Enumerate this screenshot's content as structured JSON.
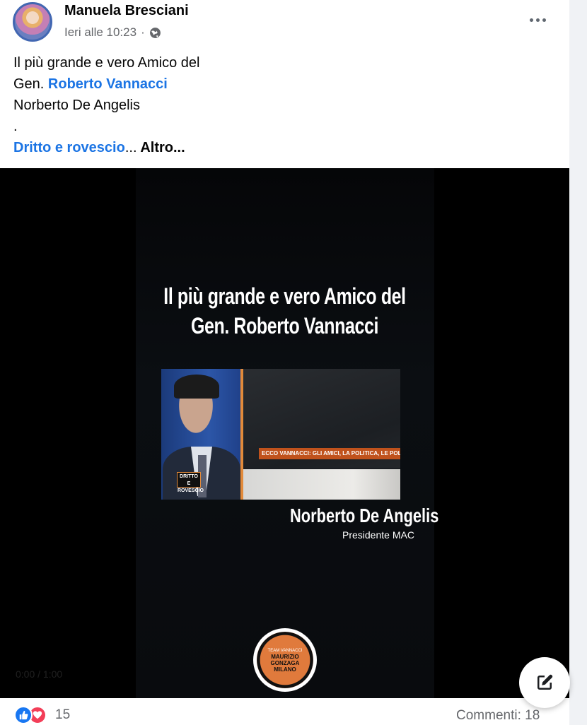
{
  "post": {
    "author": "Manuela Bresciani",
    "timestamp": "Ieri alle 10:23",
    "separator": "·",
    "privacy_icon": "globe-icon",
    "menu_icon": "more-options-icon",
    "caption": {
      "line1": "Il più grande e vero Amico del",
      "line2_prefix": "Gen. ",
      "line2_link": "Roberto Vannacci",
      "line3": "Norberto De Angelis",
      "line4": ".",
      "line5_link": "Dritto e rovescio",
      "line5_ellipsis": "...",
      "see_more": " Altro..."
    }
  },
  "video": {
    "headline_line1": "Il più grande e vero Amico del",
    "headline_line2": "Gen. Roberto Vannacci",
    "clip_ticker": "ECCO VANNACCI: GLI AMICI, LA POLITICA, LE POLEMICHE",
    "clip_logo_line1": "DRITTO E",
    "clip_logo_line2": "ROVESCIO",
    "person_name": "Norberto De Angelis",
    "person_role": "Presidente MAC",
    "badge_line1": "TEAM VANNACCI",
    "badge_line2": "MAURIZIO",
    "badge_line3": "GONZAGA",
    "badge_line4": "MILANO",
    "faint_time": "0:00 / 1:00"
  },
  "footer": {
    "reaction_icons": [
      "like-icon",
      "love-icon"
    ],
    "reaction_count": "15",
    "comments": "Commenti: 18"
  },
  "colors": {
    "link": "#1b74e4",
    "like": "#1877f2",
    "love": "#f33e58",
    "accent_orange": "#e07a3c"
  }
}
